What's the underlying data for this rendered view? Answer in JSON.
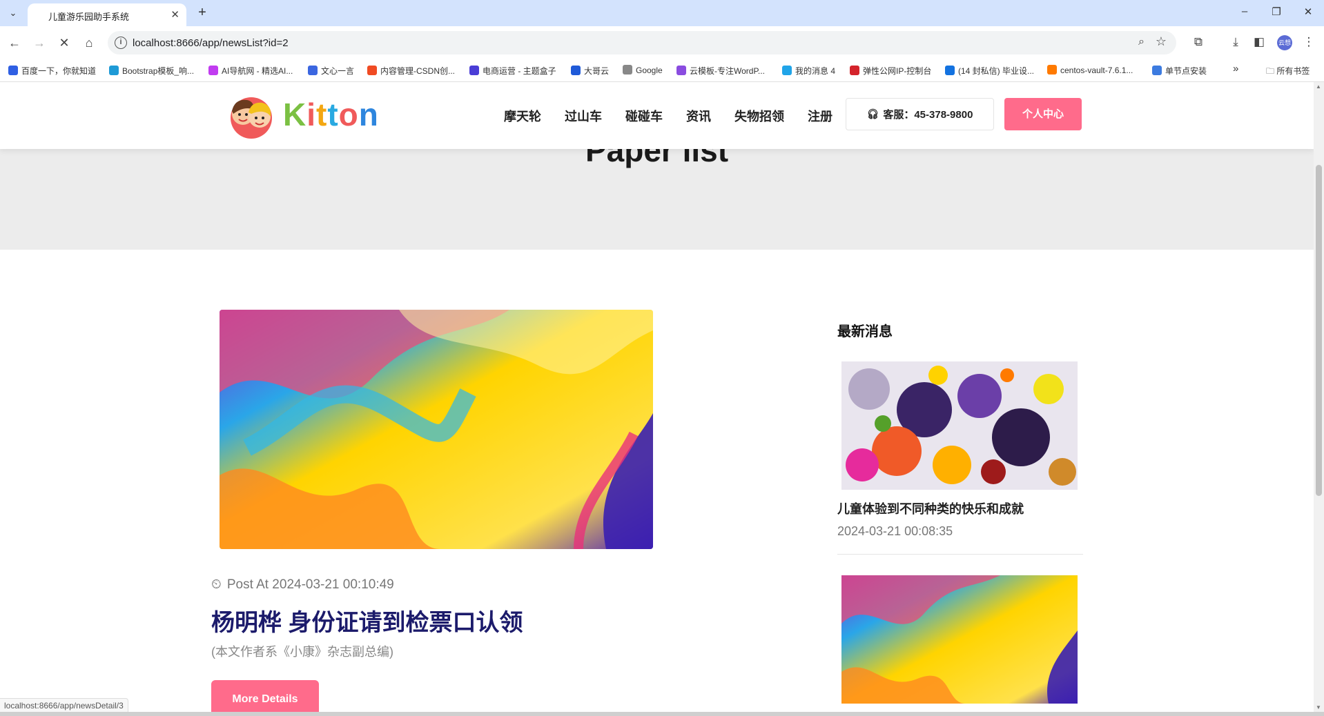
{
  "browser": {
    "tab_title": "儿童游乐园助手系统",
    "url": "localhost:8666/app/newsList?id=2",
    "status_url": "localhost:8666/app/newsDetail/3",
    "profile_label": "云想",
    "bookmarks": [
      {
        "label": "百度一下，你就知道",
        "color": "#2f5fe3"
      },
      {
        "label": "Bootstrap模板_响...",
        "color": "#1e9ad6"
      },
      {
        "label": "AI导航网 - 精选AI...",
        "color": "#c13cf0"
      },
      {
        "label": "文心一言",
        "color": "#3b66e0"
      },
      {
        "label": "内容管理-CSDN创...",
        "color": "#f04b23"
      },
      {
        "label": "电商运营 - 主题盒子",
        "color": "#4a3dd6"
      },
      {
        "label": "大哥云",
        "color": "#1f5ad8"
      },
      {
        "label": "Google",
        "color": "#888888"
      },
      {
        "label": "云模板-专注WordP...",
        "color": "#8a4ce0"
      },
      {
        "label": "我的消息 4",
        "color": "#20a4e8"
      },
      {
        "label": "弹性公网IP-控制台",
        "color": "#d4232b"
      },
      {
        "label": "(14 封私信) 毕业设...",
        "color": "#1372e0"
      },
      {
        "label": "centos-vault-7.6.1...",
        "color": "#ff7a00"
      },
      {
        "label": "单节点安装",
        "color": "#3c7be0"
      }
    ],
    "all_bookmarks": "所有书签",
    "more_bookmarks": "»"
  },
  "site": {
    "logo_text": "Kitton",
    "nav": [
      "摩天轮",
      "过山车",
      "碰碰车",
      "资讯",
      "失物招领",
      "注册"
    ],
    "phone": "客服：45-378-9800",
    "user_center": "个人中心",
    "hero_title": "Paper list"
  },
  "post": {
    "meta": "Post At 2024-03-21 00:10:49",
    "title": "杨明桦 身份证请到检票口认领",
    "excerpt": "(本文作者系《小康》杂志副总编)",
    "button": "More Details"
  },
  "sidebar": {
    "title": "最新消息",
    "items": [
      {
        "title": "儿童体验到不同种类的快乐和成就",
        "date": "2024-03-21 00:08:35"
      },
      {
        "title": "",
        "date": ""
      }
    ]
  },
  "colors": {
    "accent": "#ff6b8b",
    "title_navy": "#1c1b6b",
    "hero_bg": "#ececec"
  }
}
